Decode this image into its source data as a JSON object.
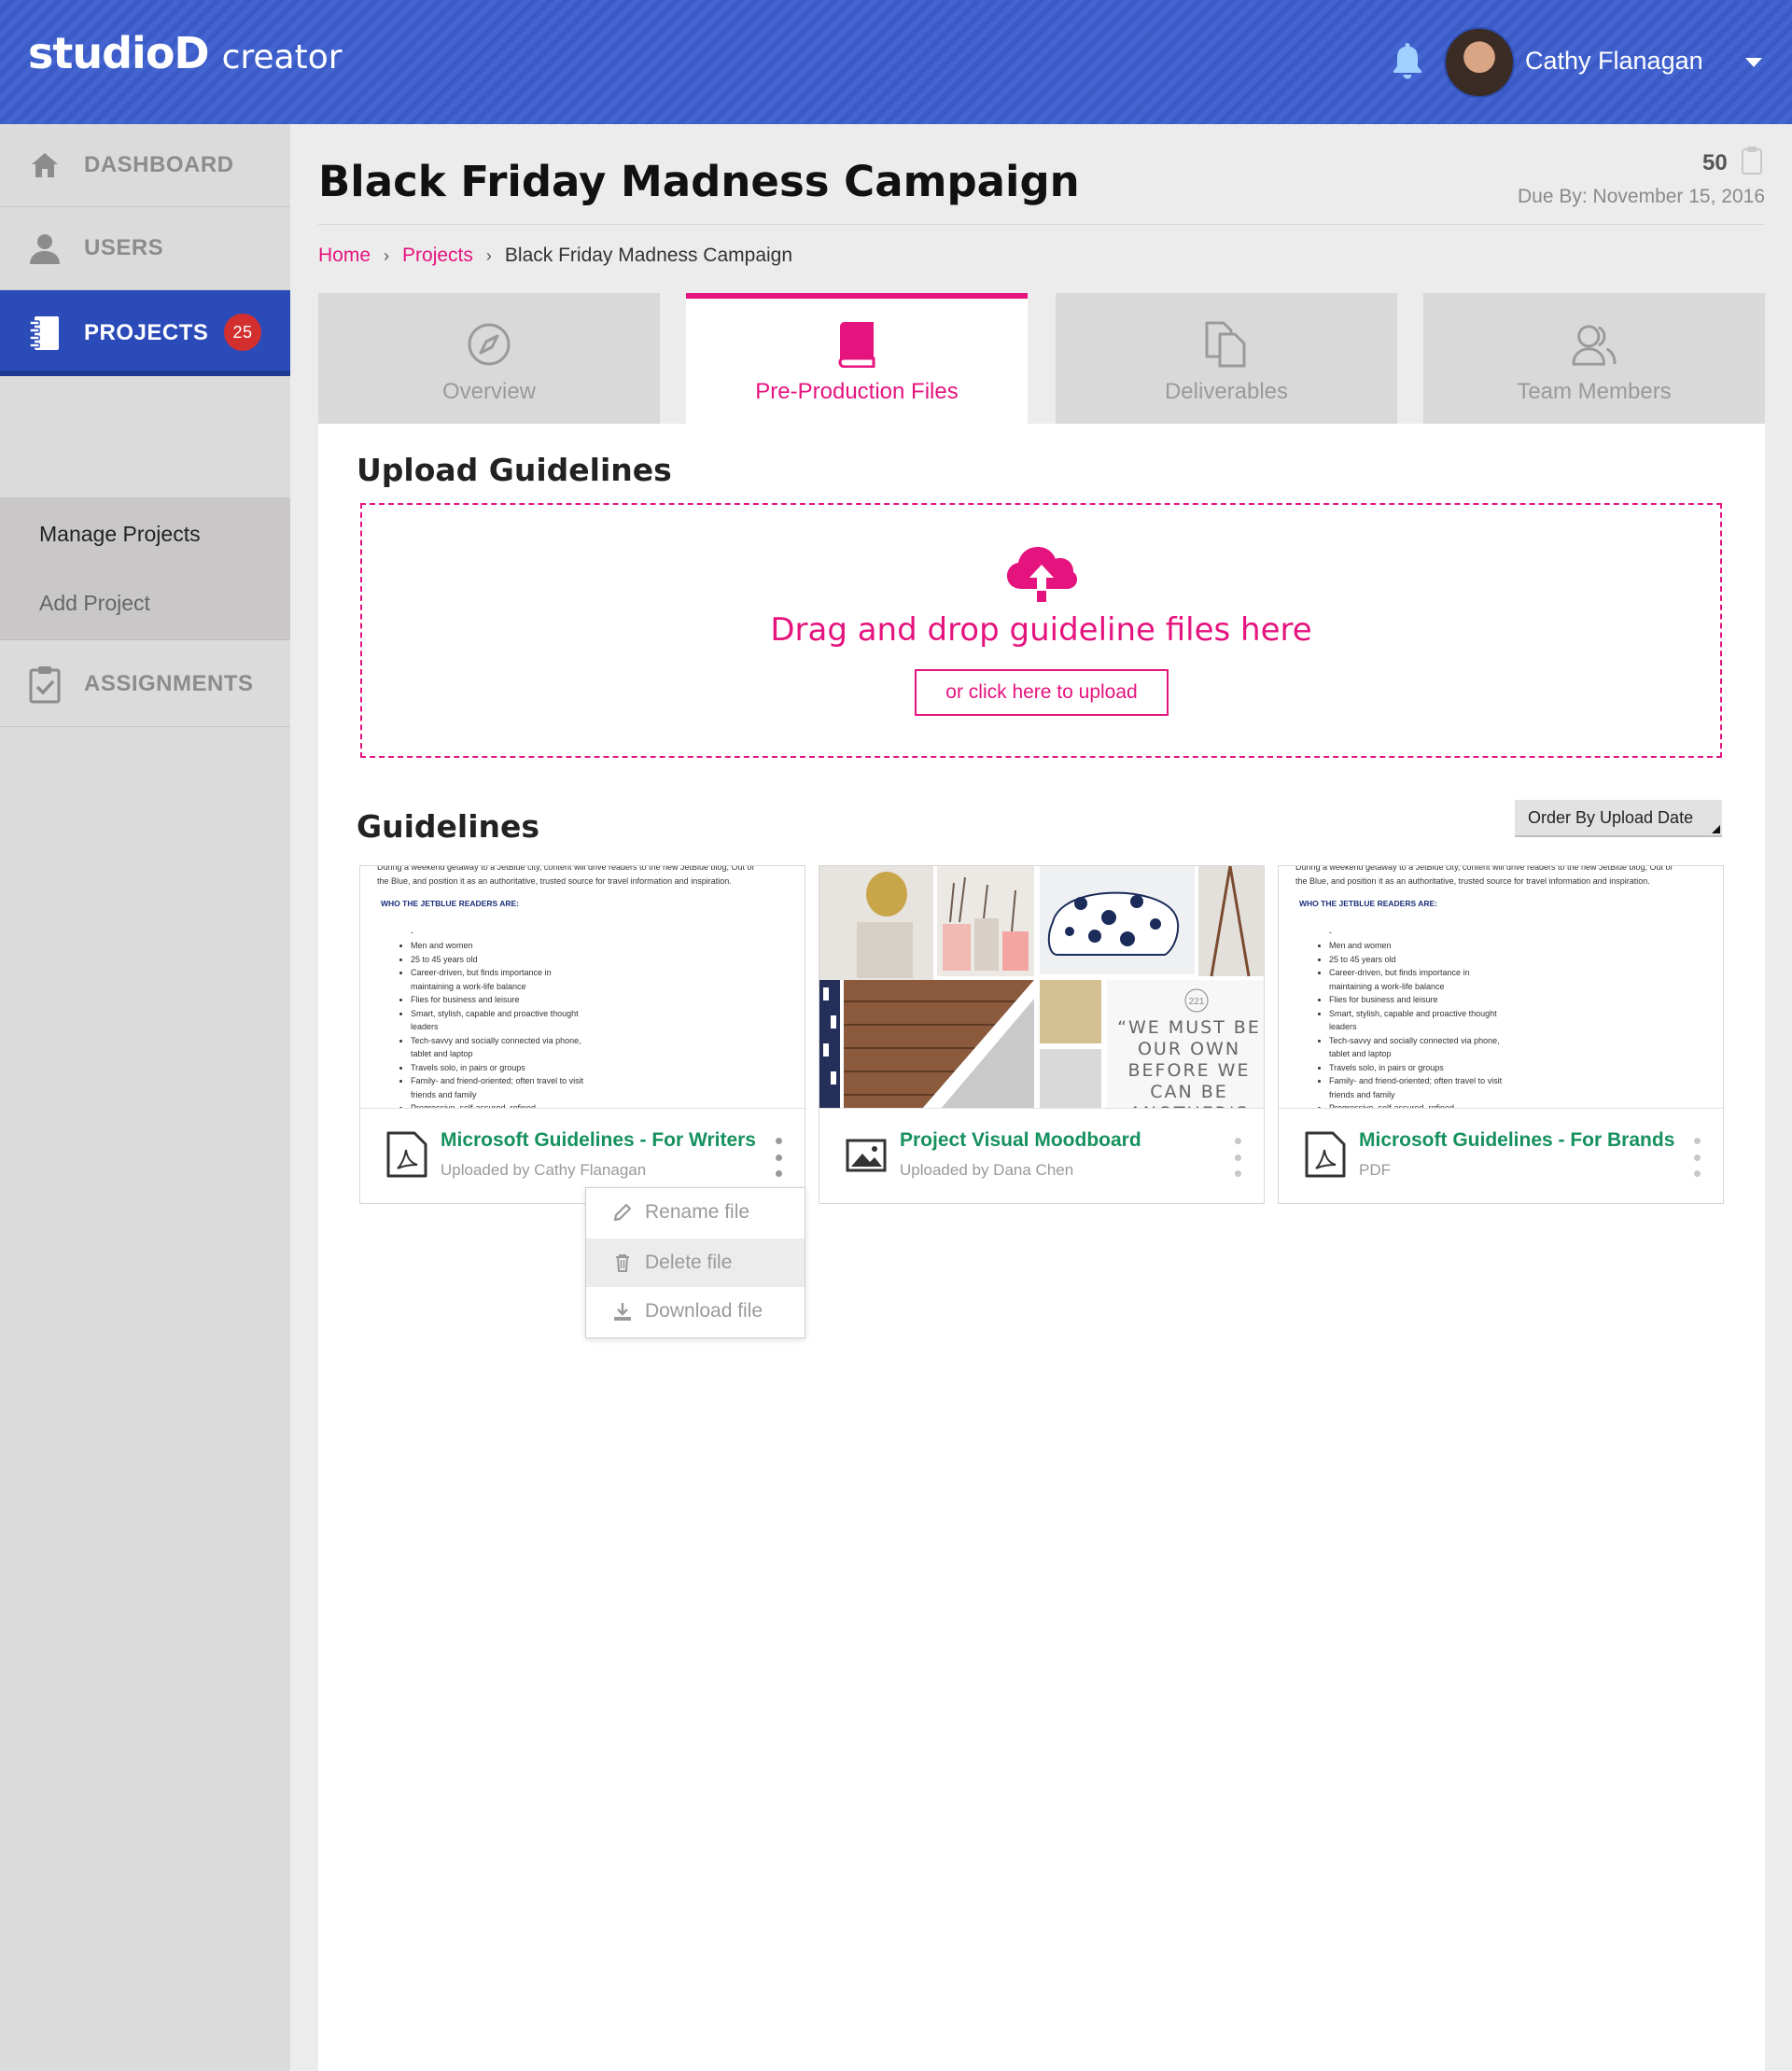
{
  "header": {
    "logo_main": "studioD",
    "logo_sub": "creator",
    "user_name": "Cathy Flanagan"
  },
  "sidebar": {
    "items": [
      {
        "label": "DASHBOARD",
        "icon": "home-icon"
      },
      {
        "label": "USERS",
        "icon": "user-icon"
      },
      {
        "label": "PROJECTS",
        "icon": "notebook-icon",
        "badge": "25",
        "active": true
      },
      {
        "label": "ASSIGNMENTS",
        "icon": "clipboard-check-icon"
      }
    ],
    "subitems": [
      "Manage Projects",
      "Add Project"
    ]
  },
  "page": {
    "title": "Black Friday Madness Campaign",
    "count": "50",
    "due": "Due By: November 15, 2016"
  },
  "breadcrumb": {
    "home": "Home",
    "projects": "Projects",
    "current": "Black Friday Madness Campaign",
    "separator": "›"
  },
  "tabs": [
    {
      "label": "Overview",
      "icon": "compass-icon"
    },
    {
      "label": "Pre-Production Files",
      "icon": "book-icon",
      "active": true
    },
    {
      "label": "Deliverables",
      "icon": "documents-icon"
    },
    {
      "label": "Team Members",
      "icon": "users-icon"
    }
  ],
  "upload": {
    "heading": "Upload Guidelines",
    "drop_text": "Drag and drop guideline files here",
    "button": "or click here to upload"
  },
  "guidelines": {
    "heading": "Guidelines",
    "order_label": "Order By Upload Date",
    "doc_preview": {
      "line1": "During a weekend getaway to a JetBlue city, content will drive readers to the new JetBlue blog, Out of",
      "line2": "the Blue, and position it as an authoritative, trusted source for travel information and inspiration.",
      "heading": "WHO THE JETBLUE READERS ARE:",
      "bullets": [
        "-",
        "Men and women",
        "25 to 45 years old",
        "Career-driven, but finds importance in maintaining a work-life balance",
        "Flies for business and leisure",
        "Smart, stylish, capable and proactive thought leaders",
        "Tech-savvy and socially connected via phone, tablet and laptop",
        "Travels solo, in pairs or groups",
        "Family- and friend-oriented; often travel to visit friends and family",
        "Progressive, self-assured, refined,"
      ]
    },
    "moodboard_quote": "“WE MUST BE OUR OWN BEFORE WE CAN BE ANOTHER'S",
    "moodboard_number": "221",
    "cards": [
      {
        "title": "Microsoft Guidelines - For Writers",
        "sub": "Uploaded by Cathy Flanagan",
        "icon": "pdf-icon"
      },
      {
        "title": "Project Visual Moodboard",
        "sub": "Uploaded by Dana Chen",
        "icon": "image-icon"
      },
      {
        "title": "Microsoft Guidelines - For Brands",
        "sub": "PDF",
        "icon": "pdf-icon"
      }
    ]
  },
  "context_menu": {
    "items": [
      "Rename file",
      "Delete file",
      "Download file"
    ]
  },
  "colors": {
    "brand_blue": "#3d5fcf",
    "accent_pink": "#e5137e",
    "title_green": "#16915e"
  }
}
